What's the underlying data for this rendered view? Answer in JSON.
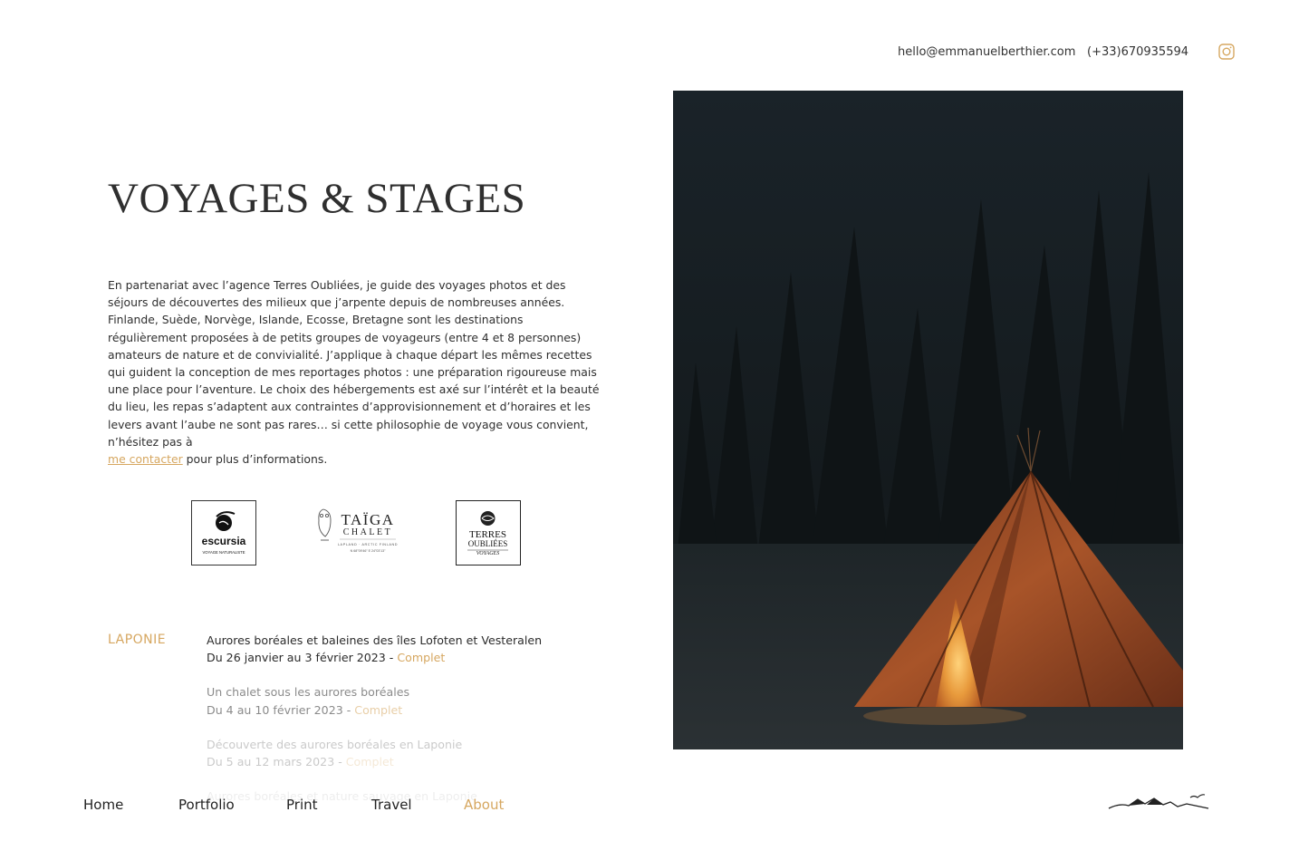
{
  "header": {
    "email": "hello@emmanuelberthier.com",
    "phone": "(+33)670935594",
    "instagram_icon": "instagram-icon"
  },
  "page": {
    "title": "VOYAGES & STAGES",
    "intro_text": "En partenariat avec l’agence Terres Oubliées, je guide des voyages photos et des séjours de découvertes des milieux que j’arpente depuis de nombreuses années. Finlande, Suède, Norvège, Islande, Ecosse, Bretagne sont les destinations régulièrement proposées à de petits groupes de voyageurs (entre 4 et 8 personnes) amateurs de nature et de convivialité. J’applique à chaque départ les mêmes recettes qui guident la conception de mes reportages photos : une préparation rigoureuse mais une place pour l’aventure. Le choix des hébergements est axé sur l’intérêt et la beauté du lieu, les repas s’adaptent aux contraintes d’approvisionnement et d’horaires et les levers avant l’aube ne sont pas rares… si cette philosophie de voyage vous convient, n’hésitez pas à",
    "contact_link": "me contacter",
    "intro_tail": " pour plus d’informations."
  },
  "partners": {
    "escursia": {
      "name": "escursia",
      "tagline": "VOYAGE NATURALISTE"
    },
    "taiga": {
      "name": "TAÏGA",
      "sub": "CHALET",
      "tagline": "LAPLAND · ARCTIC FINLAND",
      "coords": "N 68°09'46\"   E 24°03'13\""
    },
    "terres": {
      "line1": "TERRES",
      "line2": "OUBLIÉES",
      "line3": "VOYAGES"
    }
  },
  "trips": {
    "region": "LAPONIE",
    "items": [
      {
        "title": "Aurores boréales et baleines des îles Lofoten et Vesteralen",
        "dates": "Du 26 janvier au 3 février 2023 - ",
        "status": "Complet"
      },
      {
        "title": "Un chalet sous les aurores boréales",
        "dates": "Du 4 au 10 février 2023 - ",
        "status": "Complet"
      },
      {
        "title": "Découverte des aurores boréales en Laponie",
        "dates": "Du 5 au 12 mars 2023 - ",
        "status": "Complet"
      },
      {
        "title": "Aurores boréales et nature sauvage en Laponie",
        "dates": "",
        "status": ""
      }
    ]
  },
  "nav": {
    "items": [
      {
        "label": "Home"
      },
      {
        "label": "Portfolio"
      },
      {
        "label": "Print"
      },
      {
        "label": "Travel"
      },
      {
        "label": "About"
      }
    ],
    "active": "About"
  },
  "colors": {
    "accent": "#d6a760",
    "text": "#2f2f2f"
  }
}
